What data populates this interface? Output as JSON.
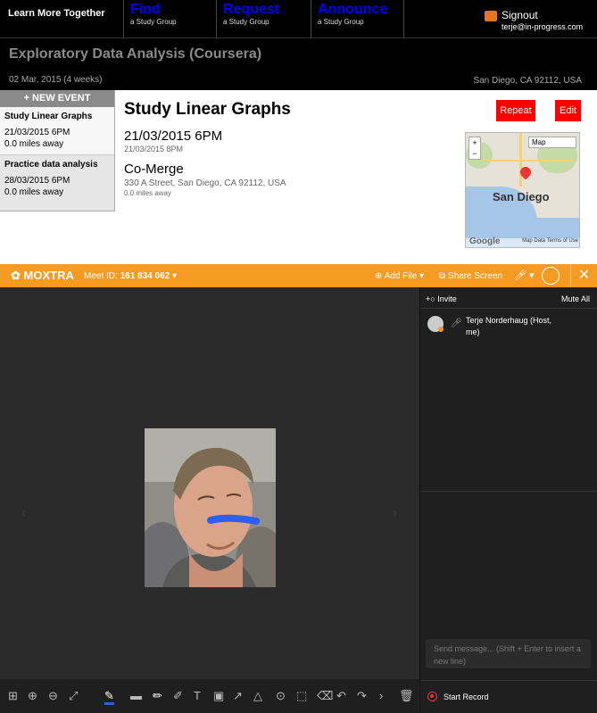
{
  "topnav": {
    "brand": "Learn More Together",
    "find": {
      "title": "Find",
      "sub": "a Study Group"
    },
    "request": {
      "title": "Request",
      "sub": "a Study Group"
    },
    "announce": {
      "title": "Announce",
      "sub": "a Study Group"
    },
    "signout": "Signout",
    "email": "terje@in-progress.com"
  },
  "group": {
    "title": "Exploratory Data Analysis (Coursera)",
    "date": "02 Mar, 2015 (4 weeks)",
    "location": "San Diego, CA 92112, USA"
  },
  "events": {
    "new_label": "+ NEW EVENT",
    "items": [
      {
        "title": "Study Linear Graphs",
        "date": "21/03/2015 6PM",
        "distance": "0.0 miles away"
      },
      {
        "title": "Practice data analysis",
        "date": "28/03/2015 6PM",
        "distance": "0.0 miles away"
      }
    ]
  },
  "detail": {
    "title": "Study Linear Graphs",
    "start": "21/03/2015 6PM",
    "end": "21/03/2015 8PM",
    "venue": "Co-Merge",
    "address": "330 A Street, San Diego, CA 92112, USA",
    "distance": "0.0 miles away",
    "repeat_label": "Repeat",
    "edit_label": "Edit"
  },
  "map": {
    "type_label": "Map",
    "city": "San Diego",
    "footer": "Map Data   Terms of Use",
    "logo": "Google",
    "zoom_in": "+",
    "zoom_out": "−"
  },
  "moxtra": {
    "logo": "MOXTRA",
    "meet_label": "Meet ID:",
    "meet_id": "161 834 062",
    "add_file": "Add File",
    "share_screen": "Share Screen",
    "invite": "Invite",
    "mute_all": "Mute All",
    "participant": "Terje Norderhaug (Host, me)",
    "message_placeholder": "Send message... (Shift + Enter to insert a new line)",
    "start_record": "Start Record",
    "accent": "#f59a23"
  },
  "toolbar_icons": [
    "grid-icon",
    "zoom-in-icon",
    "zoom-out-icon",
    "expand-icon",
    "pen-color-icon",
    "line-width-icon",
    "pen-icon",
    "highlighter-icon",
    "text-icon",
    "image-icon",
    "arrow-icon",
    "shape-icon",
    "laser-icon",
    "select-icon",
    "eraser-icon",
    "undo-icon",
    "redo-icon",
    "next-icon",
    "trash-icon"
  ]
}
